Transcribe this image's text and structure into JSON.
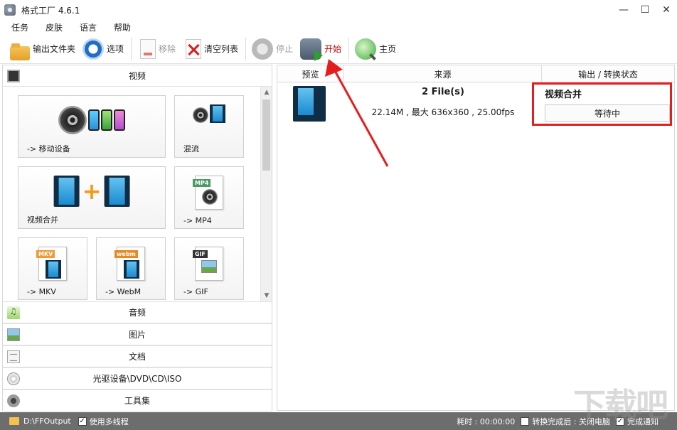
{
  "window": {
    "title": "格式工厂 4.6.1",
    "controls": {
      "minimize": "—",
      "maximize": "☐",
      "close": "✕"
    }
  },
  "menu": [
    "任务",
    "皮肤",
    "语言",
    "帮助"
  ],
  "toolbar": {
    "output_folder": "输出文件夹",
    "options": "选项",
    "remove": "移除",
    "clear_list": "清空列表",
    "stop": "停止",
    "start": "开始",
    "home": "主页"
  },
  "left": {
    "categories": {
      "video": "视频",
      "audio": "音频",
      "image": "图片",
      "document": "文档",
      "disc": "光驱设备\\DVD\\CD\\ISO",
      "tools": "工具集"
    },
    "tiles": {
      "mobile": "-> 移动设备",
      "mux": "混流",
      "merge": "视频合并",
      "mp4": "-> MP4",
      "mkv": "-> MKV",
      "webm": "-> WebM",
      "gif": "-> GIF"
    },
    "badges": {
      "mp4": "MP4",
      "mkv": "MKV",
      "webm": "webm",
      "gif": "GIF"
    }
  },
  "table": {
    "headers": {
      "preview": "预览",
      "source": "来源",
      "output": "输出 / 转换状态"
    },
    "row": {
      "files": "2 File(s)",
      "info": "22.14M , 最大 636x360 , 25.00fps",
      "output_title": "视频合并",
      "status": "等待中"
    }
  },
  "status": {
    "path": "D:\\FFOutput",
    "multithread": "使用多线程",
    "elapsed": "耗时 : 00:00:00",
    "after_convert": "转换完成后 : 关闭电脑",
    "notify": "完成通知"
  },
  "watermark": "下载吧",
  "colors": {
    "accent_red": "#e51d1d",
    "status_bar": "#6d6d6d",
    "start_label": "#cc0000"
  },
  "icons": {
    "output_folder": "folder-icon",
    "options": "options-icon",
    "remove": "remove-icon",
    "clear": "clear-list-icon",
    "stop": "stop-icon",
    "start": "start-icon",
    "home": "home-icon"
  }
}
